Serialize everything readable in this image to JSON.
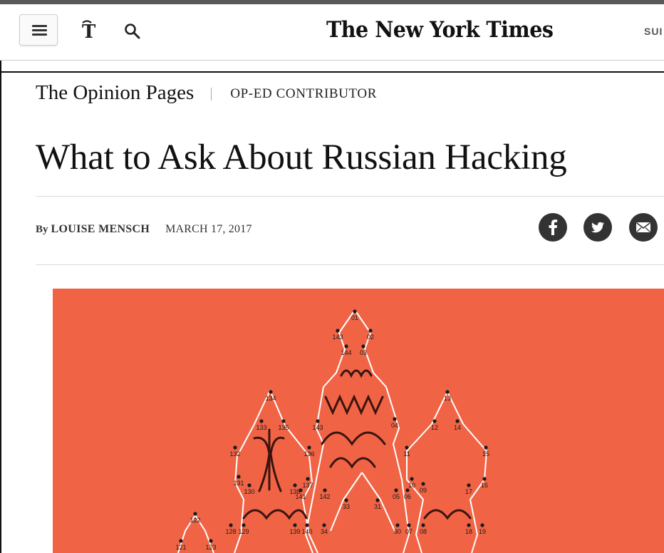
{
  "header": {
    "menu_icon": "hamburger-menu-icon",
    "logo_icon": "nyt-t-logo-icon",
    "search_icon": "search-icon",
    "masthead": "The New York Times",
    "subscribe_label": "SUI"
  },
  "section": {
    "name": "The Opinion Pages",
    "kicker": "OP-ED CONTRIBUTOR"
  },
  "article": {
    "headline": "What to Ask About Russian Hacking",
    "by": "By",
    "author": "LOUISE MENSCH",
    "date": "MARCH 17, 2017"
  },
  "share": {
    "facebook_icon": "facebook-icon",
    "twitter_icon": "twitter-icon",
    "email_icon": "email-icon"
  },
  "illustration": {
    "background_color": "#f06445",
    "labels": [
      "01",
      "02",
      "143",
      "144",
      "03",
      "134",
      "133",
      "135",
      "04",
      "143",
      "132",
      "136",
      "131",
      "130",
      "138",
      "137",
      "141",
      "142",
      "139",
      "140",
      "34",
      "33",
      "31",
      "128",
      "129",
      "30",
      "07",
      "08",
      "05",
      "06",
      "10",
      "09",
      "11",
      "12",
      "14",
      "13",
      "15",
      "17",
      "16",
      "18",
      "19",
      "122",
      "121",
      "123"
    ]
  },
  "colors": {
    "accent": "#f06445",
    "icon_dark": "#333333"
  }
}
